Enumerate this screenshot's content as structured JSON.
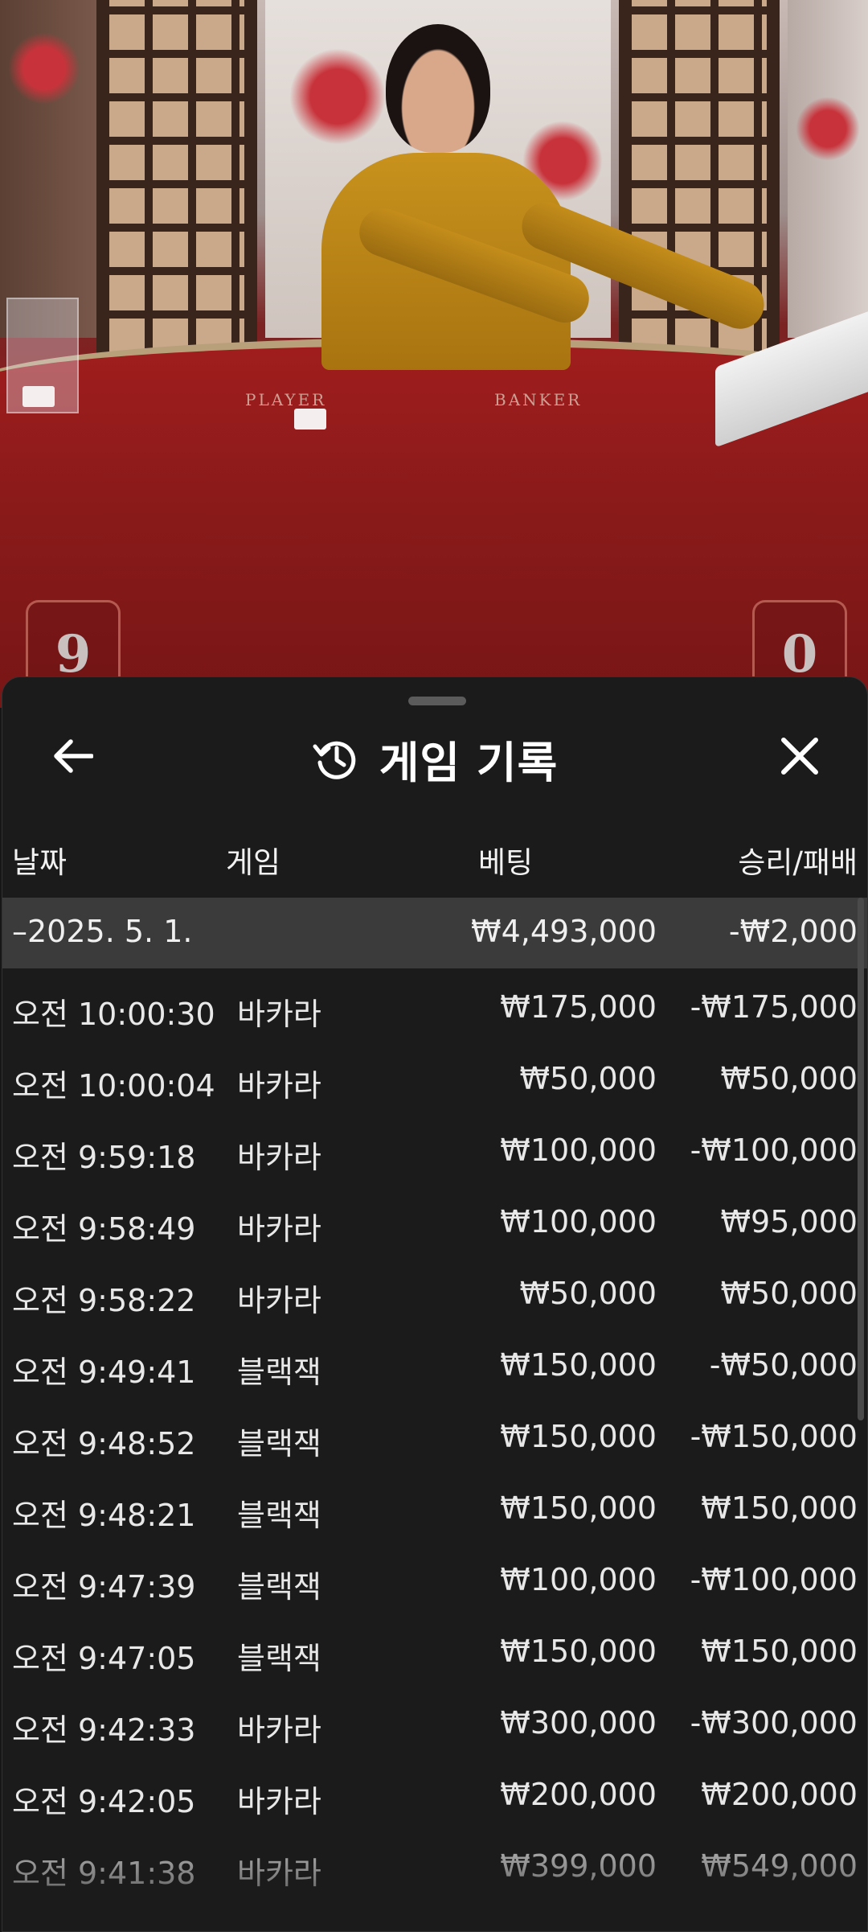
{
  "header": {
    "title": "게임 기록"
  },
  "video": {
    "table_labels": {
      "player": "PLAYER",
      "banker": "BANKER"
    },
    "scores": {
      "player": "9",
      "banker": "0"
    }
  },
  "columns": {
    "date": "날짜",
    "game": "게임",
    "bet": "베팅",
    "result": "승리/패배"
  },
  "summary": {
    "date": "–2025. 5. 1.",
    "bet": "₩4,493,000",
    "result": "-₩2,000"
  },
  "rows": [
    {
      "time": "오전 10:00:30",
      "game": "바카라",
      "bet": "₩175,000",
      "result": "-₩175,000"
    },
    {
      "time": "오전 10:00:04",
      "game": "바카라",
      "bet": "₩50,000",
      "result": "₩50,000"
    },
    {
      "time": "오전 9:59:18",
      "game": "바카라",
      "bet": "₩100,000",
      "result": "-₩100,000"
    },
    {
      "time": "오전 9:58:49",
      "game": "바카라",
      "bet": "₩100,000",
      "result": "₩95,000"
    },
    {
      "time": "오전 9:58:22",
      "game": "바카라",
      "bet": "₩50,000",
      "result": "₩50,000"
    },
    {
      "time": "오전 9:49:41",
      "game": "블랙잭",
      "bet": "₩150,000",
      "result": "-₩50,000"
    },
    {
      "time": "오전 9:48:52",
      "game": "블랙잭",
      "bet": "₩150,000",
      "result": "-₩150,000"
    },
    {
      "time": "오전 9:48:21",
      "game": "블랙잭",
      "bet": "₩150,000",
      "result": "₩150,000"
    },
    {
      "time": "오전 9:47:39",
      "game": "블랙잭",
      "bet": "₩100,000",
      "result": "-₩100,000"
    },
    {
      "time": "오전 9:47:05",
      "game": "블랙잭",
      "bet": "₩150,000",
      "result": "₩150,000"
    },
    {
      "time": "오전 9:42:33",
      "game": "바카라",
      "bet": "₩300,000",
      "result": "-₩300,000"
    },
    {
      "time": "오전 9:42:05",
      "game": "바카라",
      "bet": "₩200,000",
      "result": "₩200,000"
    },
    {
      "time": "오전 9:41:38",
      "game": "바카라",
      "bet": "₩399,000",
      "result": "₩549,000"
    }
  ],
  "icons": {
    "back": "arrow-left-icon",
    "history": "history-icon",
    "close": "close-icon"
  }
}
